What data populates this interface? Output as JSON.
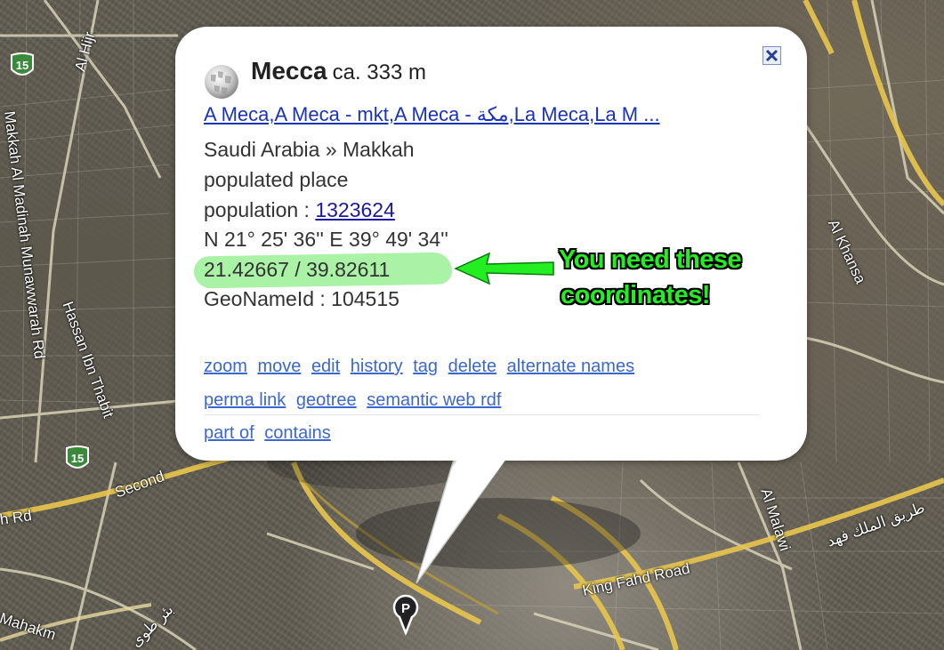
{
  "map": {
    "roads": [
      {
        "label": "Al Hijr"
      },
      {
        "label": "Makkah Al Madinah Munawwarah Rd"
      },
      {
        "label": "Hassan Ibn Thabit"
      },
      {
        "label": "Second"
      },
      {
        "label": "h Rd"
      },
      {
        "label": "Al Khansa"
      },
      {
        "label": "Al Malawi"
      },
      {
        "label": "King Fahd Road"
      },
      {
        "label": "Mahakm"
      },
      {
        "label": "طريق الملك فهد"
      },
      {
        "label": "بئر طوى"
      }
    ],
    "highway_shields": [
      {
        "number": "15"
      },
      {
        "number": "15"
      }
    ],
    "marker_letter": "P"
  },
  "popup": {
    "title": "Mecca",
    "elevation": "ca. 333 m",
    "alternate_names_link": "A Meca,A Meca - mkt,A Meca - مكة,La Meca,La M ...",
    "location": "Saudi Arabia » Makkah",
    "feature_class": "populated place",
    "population_label": "population : ",
    "population_value": "1323624",
    "dms": "N 21° 25' 36'' E 39° 49' 34''",
    "decimal": "21.42667 / 39.82611",
    "geonameid": "GeoNameId : 104515",
    "links_row1": [
      "zoom",
      "move",
      "edit",
      "history",
      "tag",
      "delete",
      "alternate names"
    ],
    "links_row2": [
      "perma link",
      "geotree",
      "semantic web rdf"
    ],
    "links_row3": [
      "part of",
      "contains"
    ]
  },
  "annotation": {
    "line1": "You need these",
    "line2": "coordinates!",
    "colors": {
      "text": "#22ee22",
      "arrow": "#22ee22",
      "highlight": "#a9f2a6"
    }
  },
  "icons": {
    "close": "close-icon",
    "logo": "wikipedia-globe-icon",
    "marker": "map-pin-icon"
  }
}
